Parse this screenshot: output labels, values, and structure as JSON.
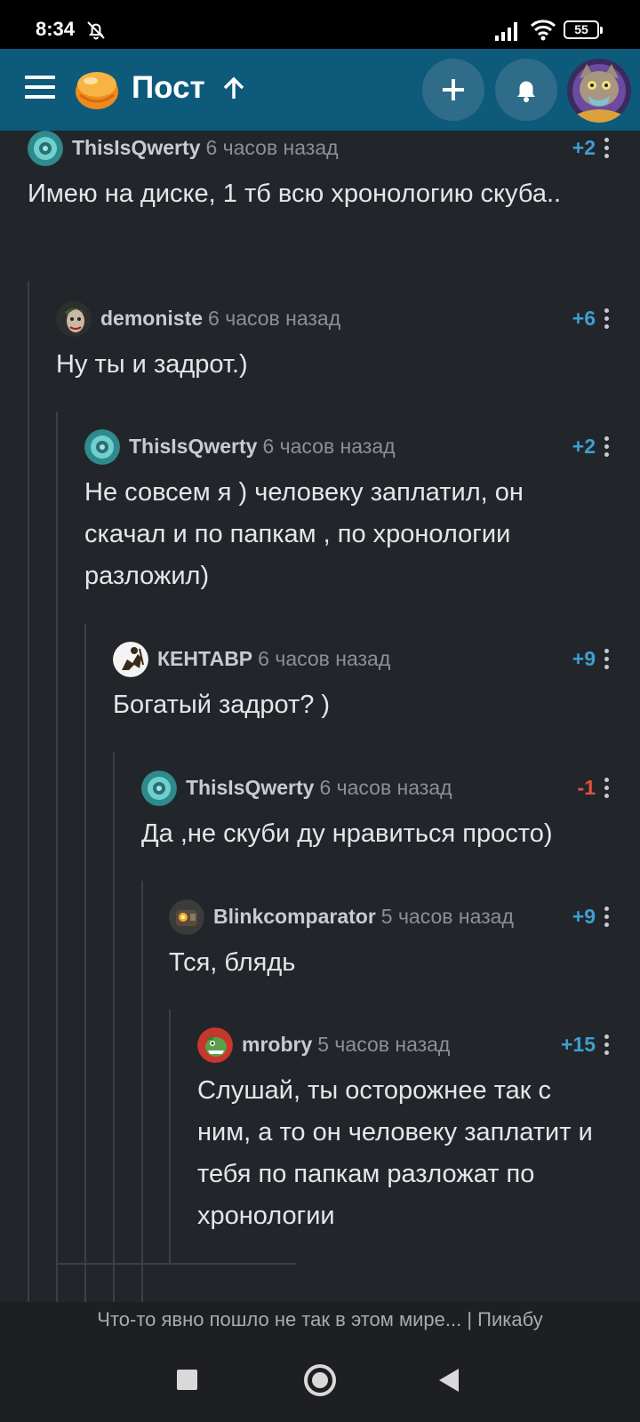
{
  "status_bar": {
    "time": "8:34",
    "battery": "55"
  },
  "header": {
    "title": "Пост"
  },
  "comments": [
    {
      "user": "ThisIsQwerty",
      "time": "6 часов назад",
      "rating": "+2",
      "text": "Имею на диске, 1 тб всю хронологию скуба.."
    },
    {
      "user": "demoniste",
      "time": "6 часов назад",
      "rating": "+6",
      "text": "Ну ты и задрот.)"
    },
    {
      "user": "ThisIsQwerty",
      "time": "6 часов назад",
      "rating": "+2",
      "text": "Не совсем я ) человеку заплатил, он скачал и по папкам , по хронологии разложил)"
    },
    {
      "user": "КЕНТАВР",
      "time": "6 часов назад",
      "rating": "+9",
      "text": "Богатый задрот? )"
    },
    {
      "user": "ThisIsQwerty",
      "time": "6 часов назад",
      "rating": "-1",
      "text": "Да ,не скуби ду нравиться просто)"
    },
    {
      "user": "Blinkcomparator",
      "time": "5 часов назад",
      "rating": "+9",
      "text": "Тся, блядь"
    },
    {
      "user": "mrobry",
      "time": "5 часов назад",
      "rating": "+15",
      "text": "Слушай, ты осторожнее так с ним, а то он человеку заплатит и тебя по папкам разложат по хронологии"
    }
  ],
  "footer": {
    "text": "Что-то явно пошло не так в этом мире... | Пикабу"
  },
  "colors": {
    "header_bg": "#0d5a7b",
    "page_bg": "#22262b",
    "rating_positive": "#3e9ed1",
    "rating_negative": "#e0533d"
  }
}
